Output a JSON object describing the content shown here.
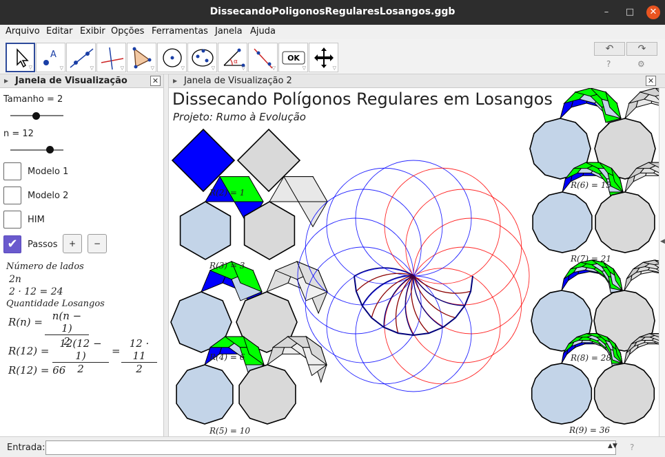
{
  "window": {
    "title": "DissecandoPoligonosRegularesLosangos.ggb",
    "minimize": "–",
    "maximize": "□",
    "close": "✕"
  },
  "menu": [
    "Arquivo",
    "Editar",
    "Exibir",
    "Opções",
    "Ferramentas",
    "Janela",
    "Ajuda"
  ],
  "toolbar": {
    "tools": [
      "move-tool",
      "point-tool",
      "line-tool",
      "perpendicular-tool",
      "polygon-tool",
      "circle-tool",
      "conic-tool",
      "angle-tool",
      "reflect-tool",
      "slider-tool",
      "move-graphics-tool"
    ],
    "ok_label": "OK",
    "undo": "↶",
    "redo": "↷",
    "help": "?",
    "settings": "⚙"
  },
  "left_panel": {
    "title": "Janela de Visualização",
    "close": "✕",
    "tamanho_label": "Tamanho = 2",
    "n_label": "n = 12",
    "tamanho_value": 2,
    "n_value": 12,
    "checkboxes": [
      {
        "label": "Modelo 1",
        "checked": false
      },
      {
        "label": "Modelo 2",
        "checked": false
      },
      {
        "label": "HIM",
        "checked": false
      },
      {
        "label": "Passos",
        "checked": true
      }
    ],
    "plus": "+",
    "minus": "−",
    "numero_lados": "Número de lados",
    "expr_2n": "2n",
    "expr_2_12": "2 · 12 = 24",
    "quantidade": "Quantidade Losangos",
    "rn_lhs": "R(n) =",
    "rn_num": "n(n − 1)",
    "rn_den": "2",
    "r12_lhs": "R(12) =",
    "r12_num1": "12(12 − 1)",
    "r12_den1": "2",
    "eq": "=",
    "r12_num2": "12 · 11",
    "r12_den2": "2",
    "r12_result": "R(12) = 66"
  },
  "graphics": {
    "panel_title": "Janela de Visualização 2",
    "close": "✕",
    "title": "Dissecando Polígonos Regulares em Losangos",
    "subtitle": "Projeto: Rumo à Evolução",
    "labels": [
      "R(2) = 1",
      "R(3) = 3",
      "R(4) = 6",
      "R(5) = 10",
      "R(6) = 15",
      "R(7) = 21",
      "R(8) = 28",
      "R(9) = 36"
    ],
    "colors": {
      "blue": "#0000ff",
      "green": "#00ff00",
      "lightblue": "#c3d4e8",
      "gray": "#d9d9d9",
      "red": "#ff0000",
      "navy": "#00007a",
      "darkred": "#8b0000"
    }
  },
  "input": {
    "label": "Entrada:",
    "value": "",
    "dropdown": "▲▼",
    "help": "?"
  }
}
